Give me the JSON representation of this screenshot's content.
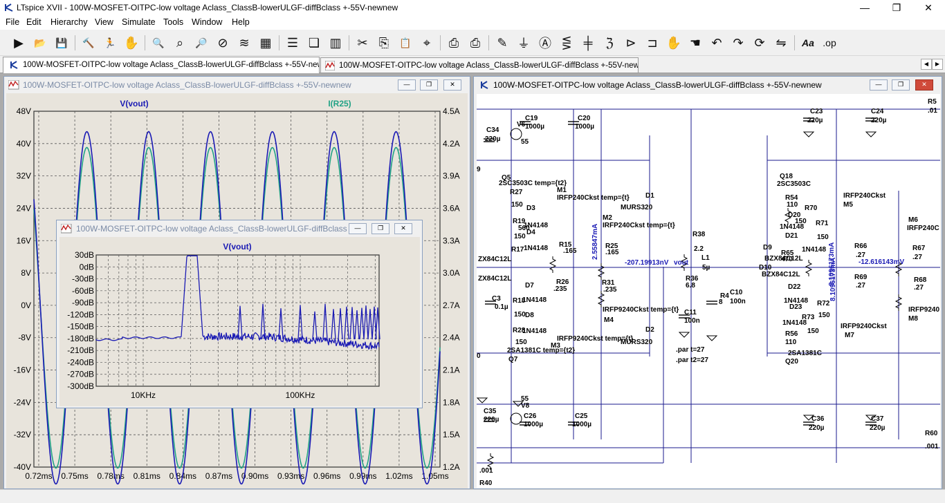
{
  "app": {
    "title": "LTspice XVII - 100W-MOSFET-OITPC-low voltage Aclass_ClassB-lowerULGF-diffBclass +-55V-newnew"
  },
  "window_controls": {
    "minimize": "—",
    "maximize": "❐",
    "close": "✕"
  },
  "menu": [
    "File",
    "Edit",
    "Hierarchy",
    "View",
    "Simulate",
    "Tools",
    "Window",
    "Help"
  ],
  "toolbar": {
    "icons": [
      "run-icon",
      "open-icon",
      "save-icon",
      "control-panel-icon",
      "halt-icon",
      "pan-icon",
      "zoom-in-icon",
      "zoom-area-icon",
      "zoom-out-icon",
      "zoom-cancel-icon",
      "autorange-icon",
      "grid-icon",
      "tile-horizontal-icon",
      "cascade-icon",
      "tile-vertical-icon",
      "cut-icon",
      "copy-icon",
      "paste-icon",
      "find-icon",
      "print-icon",
      "print-setup-icon",
      "draw-wire-icon",
      "ground-icon",
      "label-net-icon",
      "resistor-icon",
      "capacitor-icon",
      "inductor-icon",
      "diode-icon",
      "component-icon",
      "move-icon",
      "drag-icon",
      "undo-icon",
      "redo-icon",
      "rotate-icon",
      "mirror-icon",
      "text-icon",
      "spice-directive-icon"
    ],
    "text_button": "Aa",
    "directive_button": ".op"
  },
  "tabs": [
    {
      "label": "100W-MOSFET-OITPC-low voltage Aclass_ClassB-lowerULGF-diffBclass +-55V-newnew",
      "icon": "schematic-icon"
    },
    {
      "label": "100W-MOSFET-OITPC-low voltage Aclass_ClassB-lowerULGF-diffBclass +-55V-newnew",
      "icon": "waveform-icon"
    }
  ],
  "waveform_window": {
    "title": "100W-MOSFET-OITPC-low voltage Aclass_ClassB-lowerULGF-diffBclass +-55V-newnew",
    "trace_labels": [
      "V(vout)",
      "I(R25)"
    ],
    "colors": {
      "vout": "#1a1ab4",
      "ir25": "#21a285",
      "bg": "#e8e4dc",
      "axis_text": "#000000"
    },
    "left_ticks": [
      "48V",
      "40V",
      "32V",
      "24V",
      "16V",
      "8V",
      "0V",
      "-8V",
      "-16V",
      "-24V",
      "-32V",
      "-40V"
    ],
    "right_ticks": [
      "4.5A",
      "4.2A",
      "3.9A",
      "3.6A",
      "3.3A",
      "3.0A",
      "2.7A",
      "2.4A",
      "2.1A",
      "1.8A",
      "1.5A",
      "1.2A"
    ],
    "x_ticks": [
      "0.72ms",
      "0.75ms",
      "0.78ms",
      "0.81ms",
      "0.84ms",
      "0.87ms",
      "0.90ms",
      "0.93ms",
      "0.96ms",
      "0.99ms",
      "1.02ms",
      "1.05ms"
    ]
  },
  "fft_window": {
    "title": "100W-MOSFET-OITPC-low voltage Aclass_ClassB-lowerULGF-diffBclass",
    "trace_label": "V(vout)",
    "y_ticks": [
      "30dB",
      "0dB",
      "-30dB",
      "-60dB",
      "-90dB",
      "-120dB",
      "-150dB",
      "-180dB",
      "-210dB",
      "-240dB",
      "-270dB",
      "-300dB"
    ],
    "x_ticks": [
      "10KHz",
      "100KHz"
    ]
  },
  "schematic_window": {
    "title": "100W-MOSFET-OITPC-low voltage Aclass_ClassB-lowerULGF-diffBclass +-55V-newnew",
    "labels": [
      {
        "t": "C34"
      },
      {
        "t": "220µ"
      },
      {
        "t": "C19"
      },
      {
        "t": "1000µ"
      },
      {
        "t": "C20"
      },
      {
        "t": "1000µ"
      },
      {
        "t": "55"
      },
      {
        "t": "V6"
      },
      {
        "t": "C23"
      },
      {
        "t": "220µ"
      },
      {
        "t": "C24"
      },
      {
        "t": "220µ"
      },
      {
        "t": "R5"
      },
      {
        "t": ".01"
      },
      {
        "t": "9"
      },
      {
        "t": "Q5"
      },
      {
        "t": "2SC3503C temp={t2}"
      },
      {
        "t": "R27"
      },
      {
        "t": "150"
      },
      {
        "t": "M1"
      },
      {
        "t": "IRFP240Ckst temp={t}"
      },
      {
        "t": "D3"
      },
      {
        "t": "R19"
      },
      {
        "t": "1N4148"
      },
      {
        "t": "560"
      },
      {
        "t": "D4"
      },
      {
        "t": "150"
      },
      {
        "t": "1N4148"
      },
      {
        "t": "R17"
      },
      {
        "t": "R15"
      },
      {
        "t": ".165"
      },
      {
        "t": "M2"
      },
      {
        "t": "IRFP240Ckst temp={t}"
      },
      {
        "t": "R25"
      },
      {
        "t": ".165"
      },
      {
        "t": "2.55847mA"
      },
      {
        "t": "ZX84C12L"
      },
      {
        "t": "ZX84C12L"
      },
      {
        "t": "C3"
      },
      {
        "t": "0.1µ"
      },
      {
        "t": "D7"
      },
      {
        "t": "R18"
      },
      {
        "t": "1N4148"
      },
      {
        "t": "150"
      },
      {
        "t": "D8"
      },
      {
        "t": "1N4148"
      },
      {
        "t": "R26"
      },
      {
        "t": ".235"
      },
      {
        "t": "R31"
      },
      {
        "t": ".235"
      },
      {
        "t": "IRFP9240Ckst temp={t}"
      },
      {
        "t": "M4"
      },
      {
        "t": "R28"
      },
      {
        "t": "150"
      },
      {
        "t": "IRFP9240Ckst temp={t}"
      },
      {
        "t": "M3"
      },
      {
        "t": "2SA1381C temp={t2}"
      },
      {
        "t": "Q7"
      },
      {
        "t": "0"
      },
      {
        "t": "C35"
      },
      {
        "t": "220µ"
      },
      {
        "t": "V8"
      },
      {
        "t": "55"
      },
      {
        "t": "C26"
      },
      {
        "t": "1000µ"
      },
      {
        "t": "C25"
      },
      {
        "t": "1000µ"
      },
      {
        "t": "C36"
      },
      {
        "t": "220µ"
      },
      {
        "t": "C37"
      },
      {
        "t": "220µ"
      },
      {
        "t": "R60"
      },
      {
        "t": ".001"
      },
      {
        "t": ".001"
      },
      {
        "t": "R40"
      },
      {
        "t": "D1"
      },
      {
        "t": "MURS320"
      },
      {
        "t": "D2"
      },
      {
        "t": "MURS320"
      },
      {
        "t": "R38"
      },
      {
        "t": "2.2"
      },
      {
        "t": "L1"
      },
      {
        "t": "5µ"
      },
      {
        "t": "R36"
      },
      {
        "t": "6.8"
      },
      {
        "t": "R4"
      },
      {
        "t": "8"
      },
      {
        "t": "C10"
      },
      {
        "t": "100n"
      },
      {
        "t": "C11"
      },
      {
        "t": "100n"
      },
      {
        "t": "-207.19913nV"
      },
      {
        "t": "vout"
      },
      {
        "t": ".par t=27"
      },
      {
        "t": ".par t2=27"
      },
      {
        "t": "Q18"
      },
      {
        "t": "2SC3503C"
      },
      {
        "t": "R54"
      },
      {
        "t": "110"
      },
      {
        "t": "R70"
      },
      {
        "t": "D20"
      },
      {
        "t": "150"
      },
      {
        "t": "1N4148"
      },
      {
        "t": "R71"
      },
      {
        "t": "150"
      },
      {
        "t": "D21"
      },
      {
        "t": "1N4148"
      },
      {
        "t": "IRFP240Ckst"
      },
      {
        "t": "M5"
      },
      {
        "t": "M6"
      },
      {
        "t": "IRFP240C"
      },
      {
        "t": "R66"
      },
      {
        "t": ".27"
      },
      {
        "t": "R67"
      },
      {
        "t": ".27"
      },
      {
        "t": "D9"
      },
      {
        "t": "R65"
      },
      {
        "t": "470"
      },
      {
        "t": "BZX84C12L"
      },
      {
        "t": "D10"
      },
      {
        "t": "BZX84C12L"
      },
      {
        "t": "-12.616143mV"
      },
      {
        "t": "8.1096173mA"
      },
      {
        "t": "R69"
      },
      {
        "t": ".27"
      },
      {
        "t": "R68"
      },
      {
        "t": ".27"
      },
      {
        "t": "D22"
      },
      {
        "t": "1N4148"
      },
      {
        "t": "D23"
      },
      {
        "t": "R72"
      },
      {
        "t": "150"
      },
      {
        "t": "R73"
      },
      {
        "t": "150"
      },
      {
        "t": "1N4148"
      },
      {
        "t": "IRFP9240Ckst"
      },
      {
        "t": "M7"
      },
      {
        "t": "IRFP9240"
      },
      {
        "t": "M8"
      },
      {
        "t": "R56"
      },
      {
        "t": "110"
      },
      {
        "t": "2SA1381C"
      },
      {
        "t": "Q20"
      },
      {
        "t": "8.1096173mA"
      }
    ]
  }
}
